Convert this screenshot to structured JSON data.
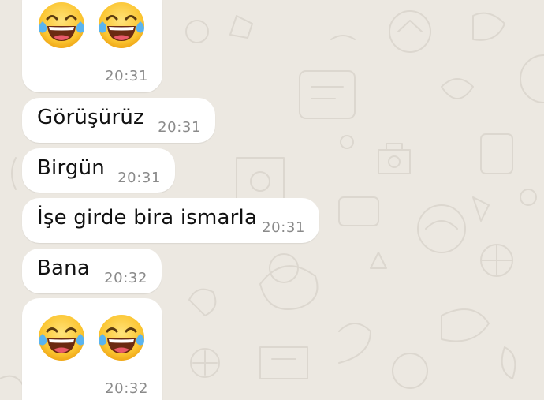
{
  "chat": {
    "background_color": "#ece8e1",
    "bubble_color": "#ffffff",
    "messages": [
      {
        "type": "emoji",
        "emojis": [
          "face-with-tears-of-joy-icon",
          "face-with-tears-of-joy-icon"
        ],
        "time": "20:31"
      },
      {
        "type": "text",
        "text": "Görüşürüz",
        "time": "20:31"
      },
      {
        "type": "text",
        "text": "Birgün",
        "time": "20:31"
      },
      {
        "type": "text",
        "text": "İşe girde bira ismarla",
        "time": "20:31"
      },
      {
        "type": "text",
        "text": "Bana",
        "time": "20:32"
      },
      {
        "type": "emoji",
        "emojis": [
          "face-with-tears-of-joy-icon",
          "face-with-tears-of-joy-icon"
        ],
        "time": "20:32"
      }
    ]
  }
}
